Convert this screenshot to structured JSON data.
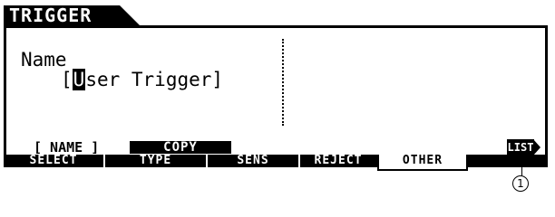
{
  "screen": {
    "title": "TRIGGER"
  },
  "name_field": {
    "label": "Name",
    "open_bracket": "[",
    "cursor_char": "U",
    "value_rest": "ser Trigger]"
  },
  "function_buttons": {
    "name": "[ NAME ]",
    "copy": "COPY",
    "list": "LIST"
  },
  "tabs": [
    {
      "label": "SELECT",
      "active": false
    },
    {
      "label": "TYPE",
      "active": false
    },
    {
      "label": "SENS",
      "active": false
    },
    {
      "label": "REJECT",
      "active": false
    },
    {
      "label": "OTHER",
      "active": true
    }
  ],
  "callout": {
    "number": "1"
  },
  "colors": {
    "foreground": "#000000",
    "background": "#ffffff"
  }
}
